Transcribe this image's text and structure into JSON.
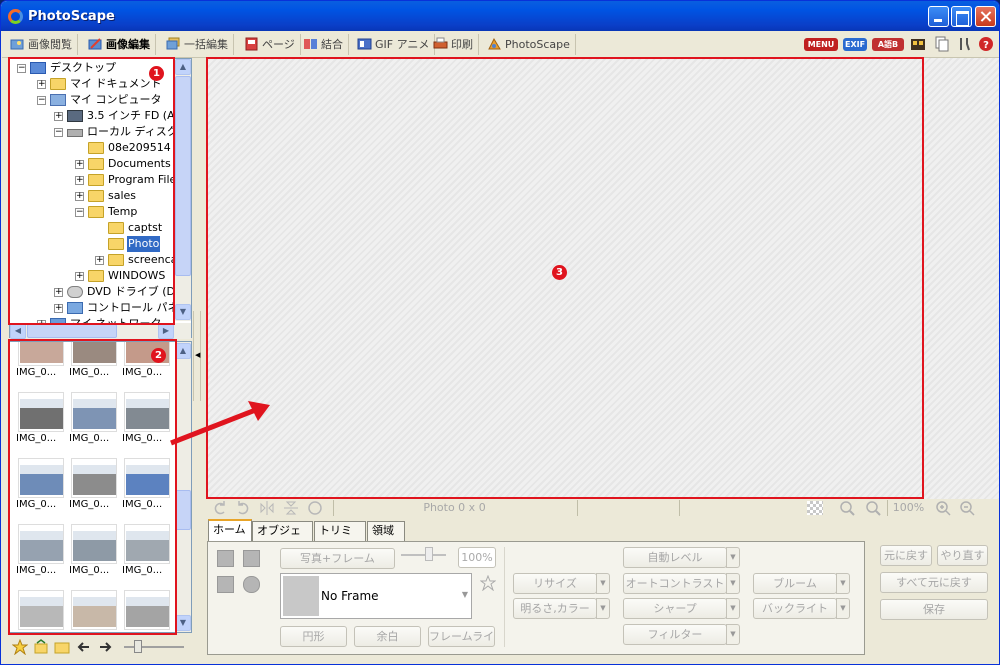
{
  "window": {
    "title": "PhotoScape",
    "colors": {
      "titlebar": "#0054e3",
      "highlight": "#e0141e",
      "selection": "#316ac5"
    }
  },
  "tabs": [
    {
      "label": "画像閲覧",
      "icon": "viewer-icon"
    },
    {
      "label": "画像編集",
      "icon": "editor-icon",
      "active": true
    },
    {
      "label": "一括編集",
      "icon": "batch-icon"
    },
    {
      "label": "ページ",
      "icon": "page-icon"
    },
    {
      "label": "結合",
      "icon": "combine-icon"
    },
    {
      "label": "GIF アニメ",
      "icon": "gif-icon"
    },
    {
      "label": "印刷",
      "icon": "print-icon"
    },
    {
      "label": "PhotoScape",
      "icon": "photoscape-icon"
    }
  ],
  "toolbar_right": {
    "menu": "MENU",
    "exif": "EXIF",
    "lang": "A語B"
  },
  "tree": {
    "items": [
      {
        "label": "デスクトップ",
        "expander": "−",
        "icon": "desktop-icon"
      },
      {
        "label": "マイ ドキュメント",
        "expander": "+",
        "icon": "mydocs-icon"
      },
      {
        "label": "マイ コンピュータ",
        "expander": "−",
        "icon": "computer-icon"
      },
      {
        "label": "3.5 インチ FD (A",
        "expander": "+",
        "icon": "floppy-icon"
      },
      {
        "label": "ローカル ディスク (",
        "expander": "−",
        "icon": "disk-icon"
      },
      {
        "label": "08e209514",
        "expander": "",
        "icon": "folder-icon"
      },
      {
        "label": "Documents",
        "expander": "+",
        "icon": "folder-icon"
      },
      {
        "label": "Program File",
        "expander": "+",
        "icon": "folder-icon"
      },
      {
        "label": "sales",
        "expander": "+",
        "icon": "folder-icon"
      },
      {
        "label": "Temp",
        "expander": "−",
        "icon": "folder-icon"
      },
      {
        "label": "captst",
        "expander": "",
        "icon": "folder-icon"
      },
      {
        "label": "Photo",
        "expander": "",
        "icon": "folder-icon",
        "selected": true
      },
      {
        "label": "screenca",
        "expander": "+",
        "icon": "folder-icon"
      },
      {
        "label": "WINDOWS",
        "expander": "+",
        "icon": "folder-icon"
      },
      {
        "label": "DVD ドライブ (D:",
        "expander": "+",
        "icon": "dvd-icon"
      },
      {
        "label": "コントロール パネル",
        "expander": "+",
        "icon": "control-panel-icon"
      },
      {
        "label": "マイ ネットワーク",
        "expander": "+",
        "icon": "network-icon"
      }
    ]
  },
  "thumbnails": [
    {
      "caption": "IMG_0...",
      "tone": "#c8a89a"
    },
    {
      "caption": "IMG_0...",
      "tone": "#9a8a80"
    },
    {
      "caption": "IMG_0...",
      "tone": "#c49a8a"
    },
    {
      "caption": "IMG_0...",
      "tone": "#707070"
    },
    {
      "caption": "IMG_0...",
      "tone": "#7e94b4"
    },
    {
      "caption": "IMG_0...",
      "tone": "#828a92"
    },
    {
      "caption": "IMG_0...",
      "tone": "#6e8cb8"
    },
    {
      "caption": "IMG_0...",
      "tone": "#8c8c8c"
    },
    {
      "caption": "IMG_0...",
      "tone": "#5c82c0"
    },
    {
      "caption": "IMG_0...",
      "tone": "#96a2b0"
    },
    {
      "caption": "IMG_0...",
      "tone": "#8e9aa6"
    },
    {
      "caption": "IMG_0...",
      "tone": "#a0a8b0"
    },
    {
      "caption": "IMG_0...",
      "tone": "#b8b8b8"
    },
    {
      "caption": "IMG_0...",
      "tone": "#c8b8a8"
    },
    {
      "caption": "IMG_0...",
      "tone": "#a4a4a4"
    }
  ],
  "annotations": {
    "one": "1",
    "two": "2",
    "three": "3"
  },
  "status": {
    "photo_info": "Photo 0 x 0",
    "zoom": "100%"
  },
  "edit_tabs": [
    {
      "label": "ホーム",
      "active": true
    },
    {
      "label": "オブジェクト"
    },
    {
      "label": "トリミング"
    },
    {
      "label": "領域"
    }
  ],
  "home_panel": {
    "photo_frame": "写真+フレーム",
    "opacity": "100%",
    "frame_name": "No Frame",
    "circle": "円形",
    "margin": "余白",
    "frame_line": "フレームライン",
    "resize": "リサイズ",
    "brightness_color": "明るさ,カラー",
    "auto_level": "自動レベル",
    "auto_contrast": "オートコントラスト",
    "sharpen": "シャープ",
    "filter": "フィルター",
    "bloom": "ブルーム",
    "backlight": "バックライト",
    "undo": "元に戻す",
    "redo": "やり直す",
    "undo_all": "すべて元に戻す",
    "save": "保存"
  }
}
